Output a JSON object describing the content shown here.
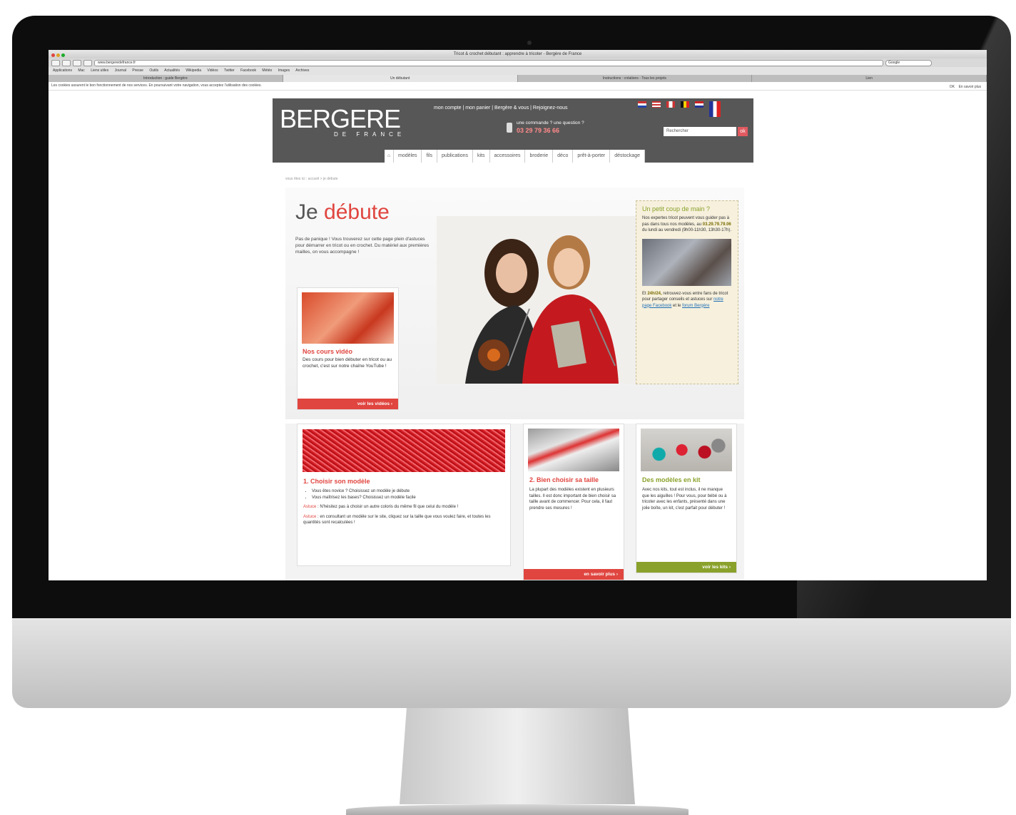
{
  "browser": {
    "window_title": "Tricot & crochet débutant : apprendre à tricoter - Bergère de France",
    "url": "www.bergeredefrance.fr",
    "search_placeholder": "Google",
    "bookmarks": [
      "Applications",
      "Mac",
      "Liens utiles",
      "Journal",
      "Presse",
      "Outils",
      "Actualités",
      "Wikipedia",
      "Vidéos",
      "Twitter",
      "Facebook",
      "Météo",
      "Images",
      "Archives"
    ],
    "tabs": [
      "Introduction : guide Bergère",
      "Un débutant",
      "Instructions : créations - Tous les projets",
      "Lien"
    ],
    "cookie_notice": "Les cookies assurent le bon fonctionnement de nos services. En poursuivant votre navigation, vous acceptez l'utilisation des cookies.",
    "cookie_ok": "OK",
    "cookie_more": "En savoir plus"
  },
  "site": {
    "logo": "BERGERE",
    "logo_sub": "DE FRANCE",
    "top_links": "mon compte | mon panier | Bergère & vous | Rejoignez-nous",
    "phone_label": "une commande ? une question ?",
    "phone_number": "03 29 79 36 66",
    "search_placeholder": "Rechercher",
    "search_button": "ok",
    "nav": [
      "modèles",
      "fils",
      "publications",
      "kits",
      "accessoires",
      "broderie",
      "déco",
      "prêt-à-porter",
      "déstockage"
    ],
    "breadcrumb": "vous êtes ici : accueil > je débute"
  },
  "hero": {
    "title_a": "Je",
    "title_b": "débute",
    "intro": "Pas de panique ! Vous trouverez sur cette page plein d'astuces pour démarrer en tricot ou en crochet. Du matériel aux premières mailles, on vous accompagne !"
  },
  "video_card": {
    "title": "Nos cours vidéo",
    "text": "Des cours pour bien débuter en tricot ou au crochet, c'est sur notre chaîne YouTube !",
    "button": "voir les vidéos ›"
  },
  "help_card": {
    "title": "Un petit coup de main ?",
    "text_a": "Nos expertes tricot peuvent vous guider pas à pas dans tous nos modèles, au",
    "phone": "03.29.79.79.06",
    "text_b": "du lundi au vendredi (9h00-11h30, 13h30-17h).",
    "text_c": "Et",
    "text_d": "retrouvez-vous entre fans de tricot pour partager conseils et astuces sur",
    "link_a": "notre page Facebook",
    "text_e": "et le",
    "link_b": "forum Bergère",
    "year": "24h/24,"
  },
  "card1": {
    "title": "1. Choisir son modèle",
    "item1": "Vous êtes novice ? Choisissez un modèle je débute",
    "item2": "Vous maîtrisez les bases? Choisissez un modèle facile",
    "tip1_label": "Astuce",
    "tip1": ": N'hésitez pas à choisir un autre coloris du même fil que celui du modèle !",
    "tip2_label": "Astuce",
    "tip2": ": en consultant un modèle sur le site, cliquez sur la taille que vous voulez faire, et toutes les quantités sont recalculées !"
  },
  "card2": {
    "title": "2. Bien choisir sa taille",
    "text": "La plupart des modèles existent en plusieurs tailles. Il est donc important de bien choisir sa taille avant de commencer. Pour cela, il faut prendre ses mesures !",
    "button": "en savoir plus ›"
  },
  "card3": {
    "title": "Des modèles en kit",
    "text": "Avec nos kits, tout est inclus, il ne manque que les aiguilles ! Pour vous, pour bébé ou à tricoter avec les enfants, présenté dans une jolie boîte, un kit, c'est parfait pour débuter !",
    "button": "voir les kits ›"
  },
  "colors": {
    "brand_red": "#e0453f",
    "header_gray": "#585757",
    "green": "#8aa22b"
  }
}
